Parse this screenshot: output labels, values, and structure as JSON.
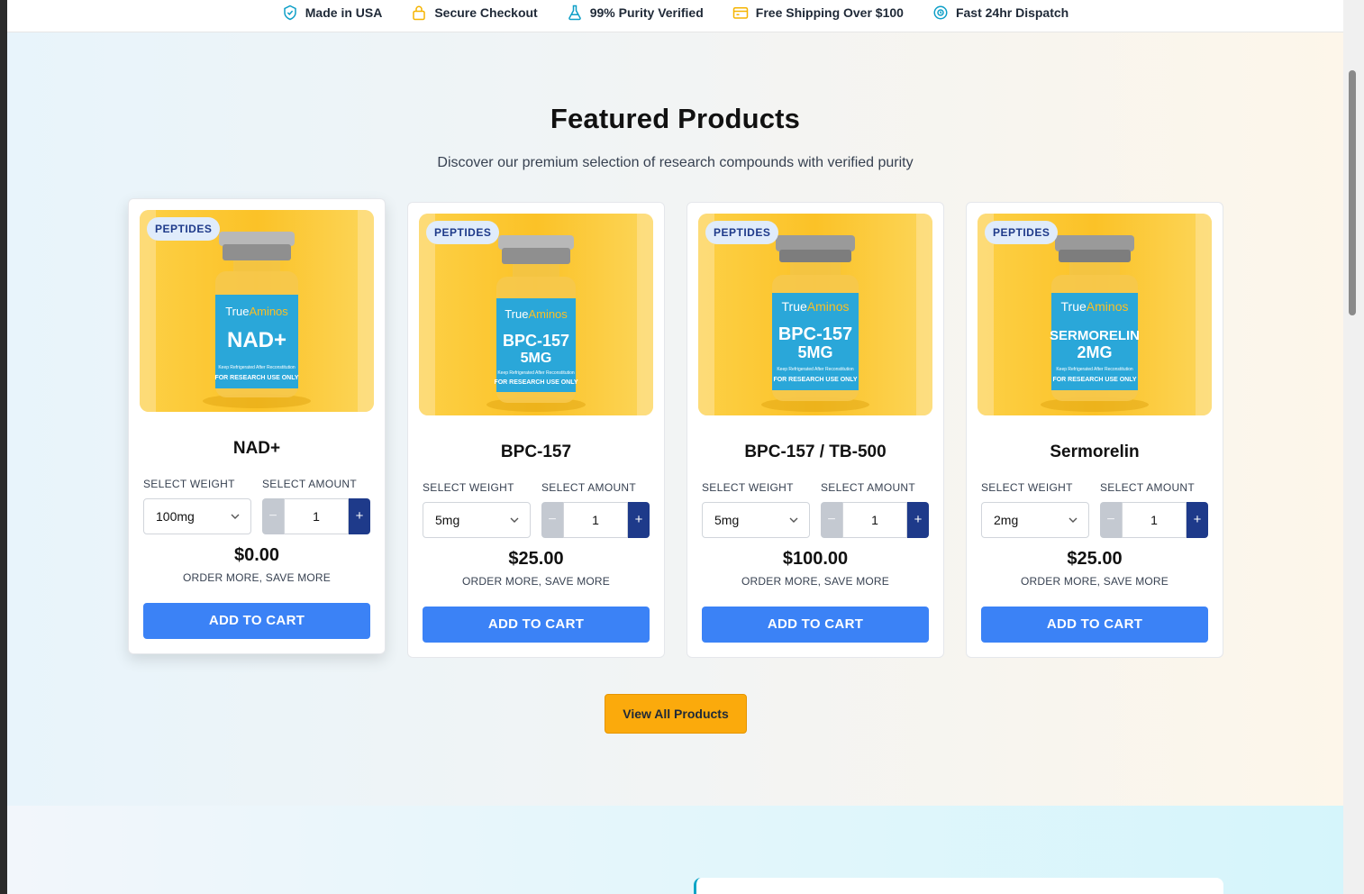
{
  "trust_bar": [
    {
      "label": "Made in USA",
      "icon": "shield-check-icon"
    },
    {
      "label": "Secure Checkout",
      "icon": "lock-icon"
    },
    {
      "label": "99% Purity Verified",
      "icon": "flask-icon"
    },
    {
      "label": "Free Shipping Over $100",
      "icon": "truck-icon"
    },
    {
      "label": "Fast 24hr Dispatch",
      "icon": "clock-icon"
    }
  ],
  "featured": {
    "title": "Featured Products",
    "subtitle": "Discover our premium selection of research compounds with verified purity",
    "view_all_label": "View All Products"
  },
  "labels": {
    "weight": "SELECT WEIGHT",
    "amount": "SELECT AMOUNT",
    "promo": "ORDER MORE, SAVE MORE",
    "add_to_cart": "ADD TO CART",
    "minus": "−",
    "plus": "+"
  },
  "products": [
    {
      "badge": "PEPTIDES",
      "name": "NAD+",
      "vial_brand_a": "True",
      "vial_brand_b": "Aminos",
      "vial_line1": "NAD+",
      "vial_line2": "",
      "vial_note": "Keep Refrigerated After Reconstitution",
      "vial_ruo": "FOR RESEARCH USE ONLY",
      "weight": "100mg",
      "qty": "1",
      "price": "$0.00"
    },
    {
      "badge": "PEPTIDES",
      "name": "BPC-157",
      "vial_brand_a": "True",
      "vial_brand_b": "Aminos",
      "vial_line1": "BPC-157",
      "vial_line2": "5MG",
      "vial_note": "Keep Refrigerated After Reconstitution",
      "vial_ruo": "FOR RESEARCH USE ONLY",
      "weight": "5mg",
      "qty": "1",
      "price": "$25.00"
    },
    {
      "badge": "PEPTIDES",
      "name": "BPC-157 / TB-500",
      "vial_brand_a": "True",
      "vial_brand_b": "Aminos",
      "vial_line1": "BPC-157",
      "vial_line2": "5MG",
      "vial_note": "Keep Refrigerated After Reconstitution",
      "vial_ruo": "FOR RESEARCH USE ONLY",
      "weight": "5mg",
      "qty": "1",
      "price": "$100.00"
    },
    {
      "badge": "PEPTIDES",
      "name": "Sermorelin",
      "vial_brand_a": "True",
      "vial_brand_b": "Aminos",
      "vial_line1": "SERMORELIN",
      "vial_line2": "2MG",
      "vial_note": "Keep Refrigerated After Reconstitution",
      "vial_ruo": "FOR RESEARCH USE ONLY",
      "weight": "2mg",
      "qty": "1",
      "price": "$25.00"
    }
  ],
  "colors": {
    "accent_blue": "#3b82f6",
    "navy": "#1e3a8a",
    "cta_orange": "#fbaa0c",
    "vial_label": "#2aa7d9"
  }
}
